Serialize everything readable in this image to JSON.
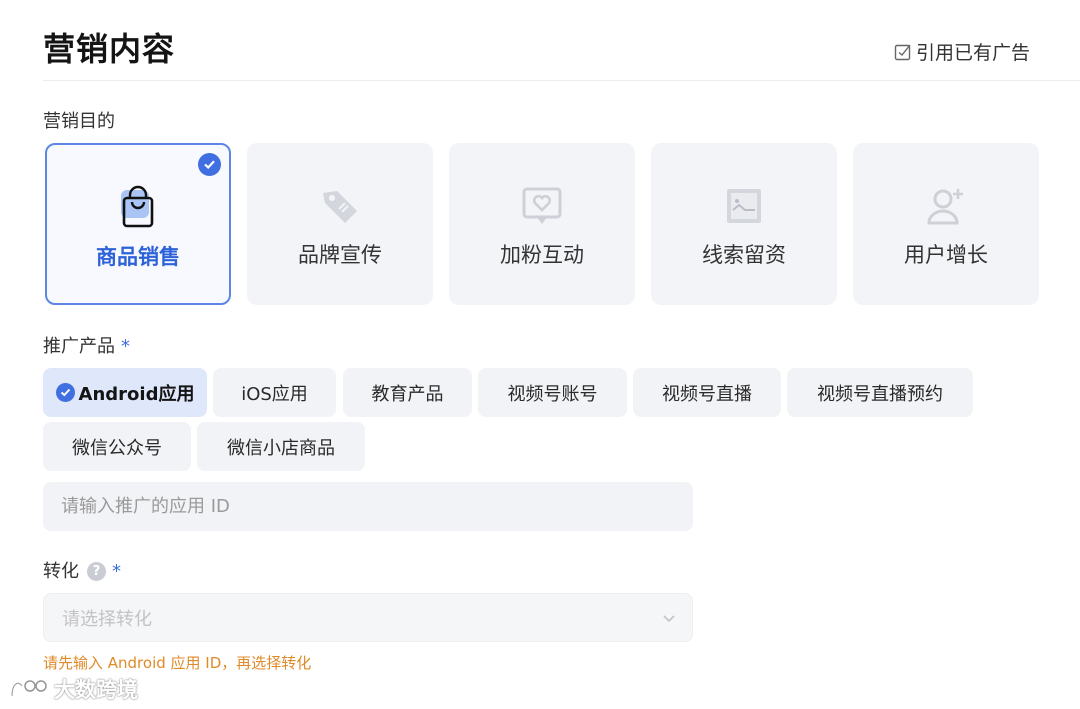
{
  "header": {
    "title": "营销内容",
    "reference_ad_label": "引用已有广告"
  },
  "purpose": {
    "label": "营销目的",
    "options": [
      {
        "label": "商品销售",
        "icon": "shopping-bag-icon",
        "selected": true
      },
      {
        "label": "品牌宣传",
        "icon": "tag-icon",
        "selected": false
      },
      {
        "label": "加粉互动",
        "icon": "heart-message-icon",
        "selected": false
      },
      {
        "label": "线索留资",
        "icon": "form-image-icon",
        "selected": false
      },
      {
        "label": "用户增长",
        "icon": "user-add-icon",
        "selected": false
      }
    ]
  },
  "product": {
    "label": "推广产品",
    "required_mark": "*",
    "options": [
      {
        "label": "Android应用",
        "selected": true
      },
      {
        "label": "iOS应用",
        "selected": false
      },
      {
        "label": "教育产品",
        "selected": false
      },
      {
        "label": "视频号账号",
        "selected": false
      },
      {
        "label": "视频号直播",
        "selected": false
      },
      {
        "label": "视频号直播预约",
        "selected": false
      },
      {
        "label": "微信公众号",
        "selected": false
      },
      {
        "label": "微信小店商品",
        "selected": false
      }
    ],
    "app_id_placeholder": "请输入推广的应用 ID"
  },
  "conversion": {
    "label": "转化",
    "help_symbol": "?",
    "required_mark": "*",
    "select_placeholder": "请选择转化",
    "hint": "请先输入 Android 应用 ID，再选择转化"
  },
  "watermark": {
    "text": "大数跨境"
  },
  "colors": {
    "accent": "#3f6fe0",
    "selected_card_border": "#5d86e6",
    "hint": "#e08a28",
    "chip_bg": "#f2f3f6"
  }
}
